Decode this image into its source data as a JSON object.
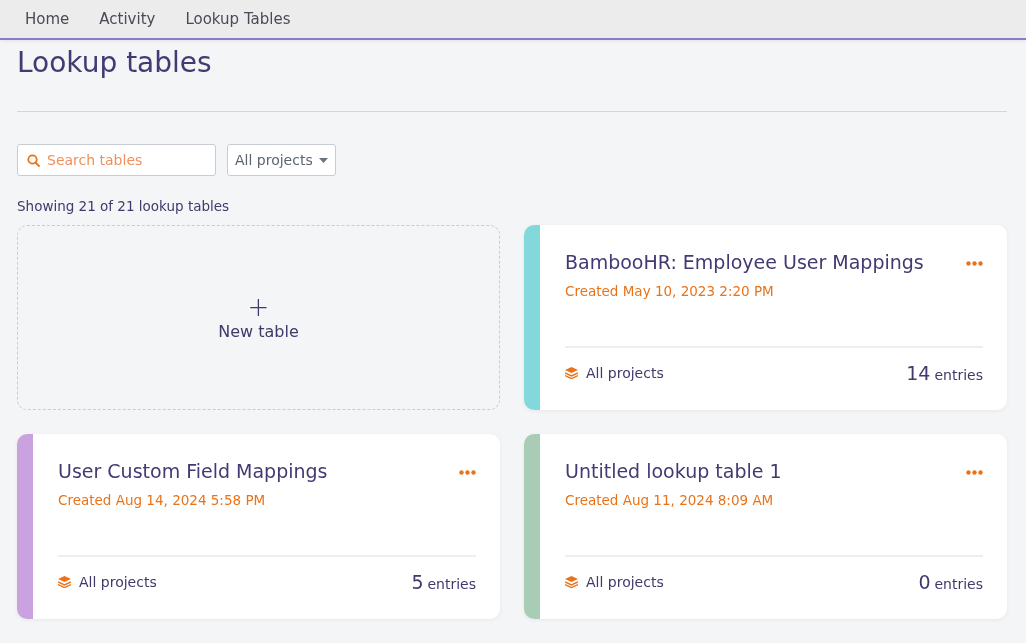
{
  "nav": {
    "items": [
      {
        "label": "Home"
      },
      {
        "label": "Activity"
      },
      {
        "label": "Lookup Tables"
      }
    ]
  },
  "page_title": "Lookup tables",
  "search": {
    "placeholder": "Search tables"
  },
  "project_filter": {
    "value": "All projects"
  },
  "summary": "Showing 21 of 21 lookup tables",
  "new_table": {
    "label": "New table",
    "icon": "+"
  },
  "tables": [
    {
      "name": "BambooHR: Employee User Mappings",
      "created": "Created May 10, 2023 2:20 PM",
      "project": "All projects",
      "count": "14",
      "unit": "entries",
      "color": "#82d8da"
    },
    {
      "name": "User Custom Field Mappings",
      "created": "Created Aug 14, 2024 5:58 PM",
      "project": "All projects",
      "count": "5",
      "unit": "entries",
      "color": "#c9a2df"
    },
    {
      "name": "Untitled lookup table 1",
      "created": "Created Aug 11, 2024 8:09 AM",
      "project": "All projects",
      "count": "0",
      "unit": "entries",
      "color": "#a9ccb6"
    }
  ]
}
